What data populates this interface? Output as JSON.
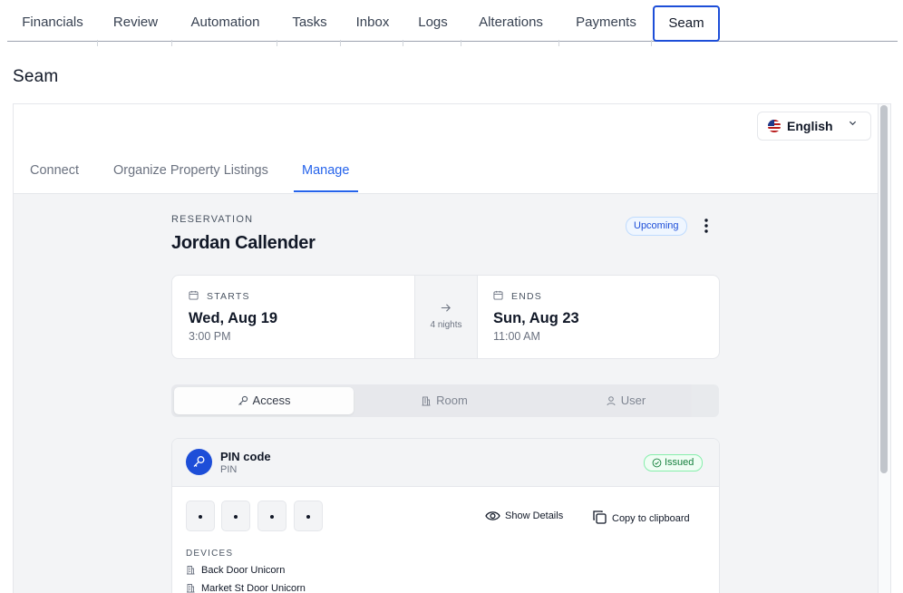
{
  "top_tabs": [
    {
      "label": "Financials"
    },
    {
      "label": "Review"
    },
    {
      "label": "Automation"
    },
    {
      "label": "Tasks"
    },
    {
      "label": "Inbox"
    },
    {
      "label": "Logs"
    },
    {
      "label": "Alterations"
    },
    {
      "label": "Payments"
    },
    {
      "label": "Seam",
      "active": true
    }
  ],
  "page_title": "Seam",
  "language": {
    "label": "English",
    "flag": "us-flag-icon"
  },
  "subtabs": [
    {
      "label": "Connect"
    },
    {
      "label": "Organize Property Listings"
    },
    {
      "label": "Manage",
      "active": true
    }
  ],
  "reservation": {
    "section_label": "RESERVATION",
    "guest_name": "Jordan Callender",
    "status": "Upcoming",
    "starts": {
      "caption": "STARTS",
      "date": "Wed, Aug 19",
      "time": "3:00 PM"
    },
    "ends": {
      "caption": "ENDS",
      "date": "Sun, Aug 23",
      "time": "11:00 AM"
    },
    "nights": "4 nights"
  },
  "segment_tabs": [
    {
      "label": "Access",
      "icon": "key-icon",
      "active": true
    },
    {
      "label": "Room",
      "icon": "building-icon"
    },
    {
      "label": "User",
      "icon": "user-icon"
    }
  ],
  "access_card": {
    "title": "PIN code",
    "subtitle": "PIN",
    "status": "Issued",
    "pin_digits": 4,
    "show_details": "Show Details",
    "copy": "Copy to clipboard",
    "devices_label": "DEVICES",
    "devices": [
      "Back Door Unicorn",
      "Market St Door Unicorn"
    ]
  },
  "colors": {
    "accent": "#2563eb",
    "issued": "#15803d",
    "badge_blue": "#1d4ed8"
  }
}
